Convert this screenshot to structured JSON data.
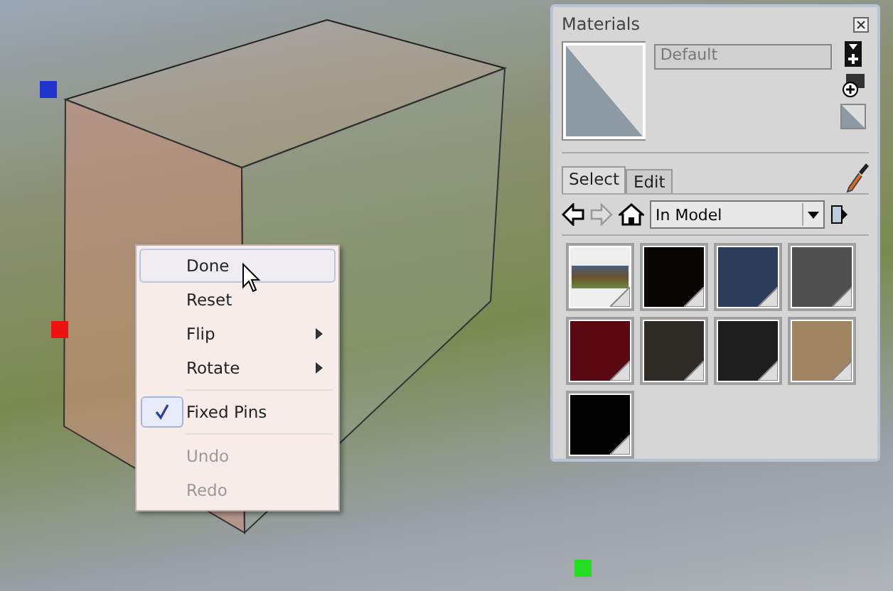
{
  "context_menu": {
    "items": [
      {
        "kind": "item",
        "label": "Done",
        "selected": true,
        "checked": false,
        "disabled": false,
        "submenu": false
      },
      {
        "kind": "item",
        "label": "Reset",
        "selected": false,
        "checked": false,
        "disabled": false,
        "submenu": false
      },
      {
        "kind": "item",
        "label": "Flip",
        "selected": false,
        "checked": false,
        "disabled": false,
        "submenu": true
      },
      {
        "kind": "item",
        "label": "Rotate",
        "selected": false,
        "checked": false,
        "disabled": false,
        "submenu": true
      },
      {
        "kind": "separator"
      },
      {
        "kind": "item",
        "label": "Fixed Pins",
        "selected": false,
        "checked": true,
        "disabled": false,
        "submenu": false
      },
      {
        "kind": "separator"
      },
      {
        "kind": "item",
        "label": "Undo",
        "selected": false,
        "checked": false,
        "disabled": true,
        "submenu": false
      },
      {
        "kind": "item",
        "label": "Redo",
        "selected": false,
        "checked": false,
        "disabled": true,
        "submenu": false
      }
    ]
  },
  "materials_panel": {
    "title": "Materials",
    "name_field": {
      "value": "Default"
    },
    "tabs": [
      {
        "label": "Select",
        "selected": true
      },
      {
        "label": "Edit",
        "selected": false
      }
    ],
    "collection_dropdown": {
      "value": "In Model"
    },
    "swatches": [
      {
        "kind": "texture",
        "selected": false
      },
      {
        "kind": "color",
        "color": "#0a0606",
        "selected": false
      },
      {
        "kind": "color",
        "color": "#2c3d5c",
        "selected": false
      },
      {
        "kind": "color",
        "color": "#505050",
        "selected": false
      },
      {
        "kind": "color",
        "color": "#5a0812",
        "selected": false
      },
      {
        "kind": "color",
        "color": "#2e2a26",
        "selected": false
      },
      {
        "kind": "color",
        "color": "#1e1e1e",
        "selected": false
      },
      {
        "kind": "color",
        "color": "#a08562",
        "selected": false
      },
      {
        "kind": "color",
        "color": "#020202",
        "selected": false
      }
    ]
  }
}
